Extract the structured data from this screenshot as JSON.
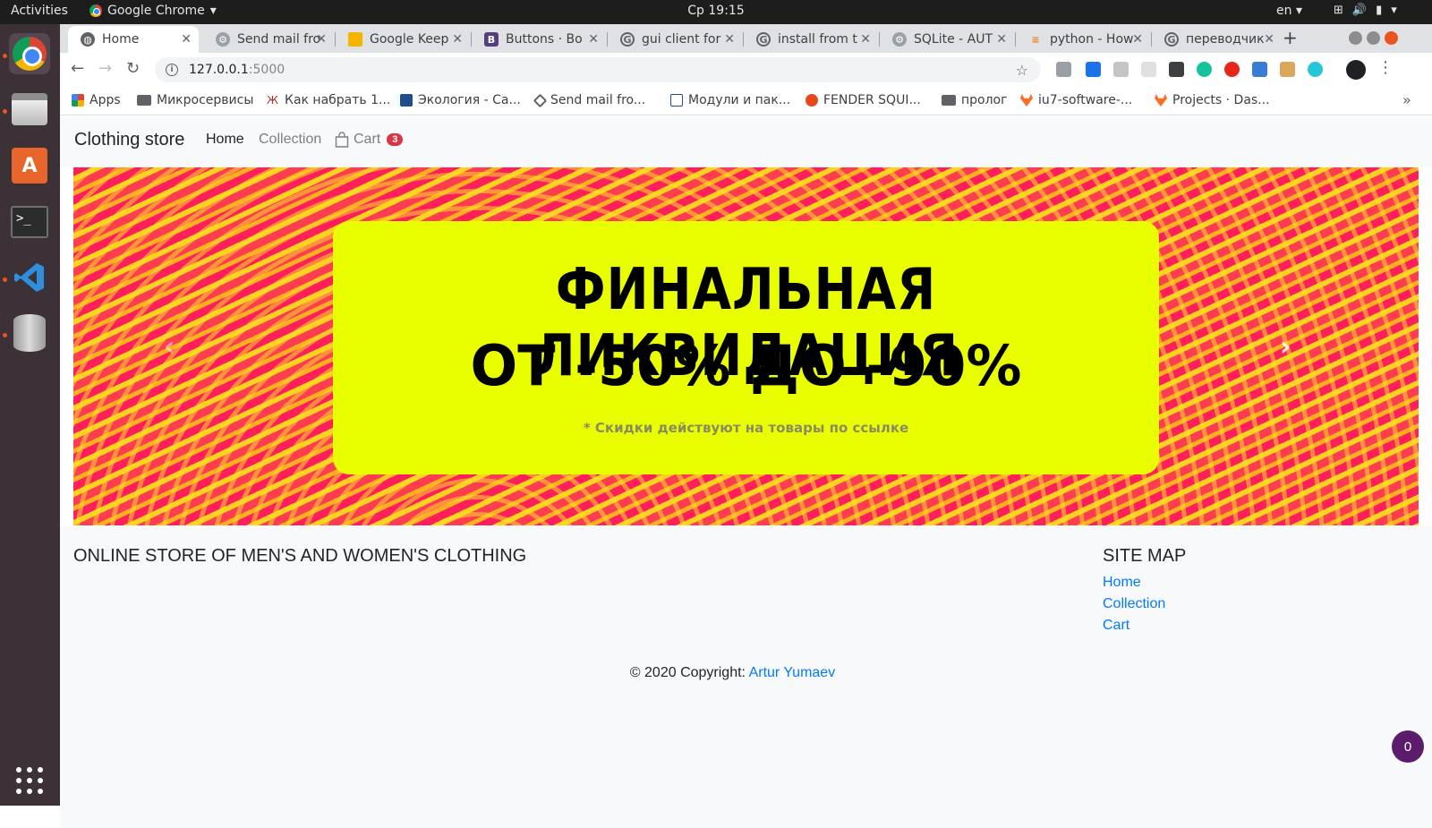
{
  "topbar": {
    "activities": "Activities",
    "app_name": "Google Chrome",
    "clock": "Ср 19:15",
    "lang": "en"
  },
  "tabs": [
    {
      "title": "Home",
      "favicon": "globe-icon",
      "active": true
    },
    {
      "title": "Send mail fro",
      "favicon": "gear-icon"
    },
    {
      "title": "Google Keep",
      "favicon": "keep-icon"
    },
    {
      "title": "Buttons · Bo",
      "favicon": "bootstrap-icon"
    },
    {
      "title": "gui client for",
      "favicon": "google-icon"
    },
    {
      "title": "install from t",
      "favicon": "google-icon"
    },
    {
      "title": "SQLite - AUT",
      "favicon": "gear-icon"
    },
    {
      "title": "python - How",
      "favicon": "stackoverflow-icon"
    },
    {
      "title": "переводчик",
      "favicon": "google-icon"
    }
  ],
  "omnibox": {
    "host": "127.0.0.1",
    "port": ":5000"
  },
  "bookmarks": [
    {
      "label": "Apps",
      "icon": "apps-grid-icon"
    },
    {
      "label": "Микросервисы",
      "icon": "folder-icon"
    },
    {
      "label": "Как набрать 1...",
      "icon": "page-icon"
    },
    {
      "label": "Экология - Са...",
      "icon": "e9-icon"
    },
    {
      "label": "Send mail fro...",
      "icon": "diamond-icon"
    },
    {
      "label": "Модули и пак...",
      "icon": "chart-icon"
    },
    {
      "label": "FENDER SQUI...",
      "icon": "circle-icon"
    },
    {
      "label": "пролог",
      "icon": "folder-icon"
    },
    {
      "label": "iu7-software-...",
      "icon": "gitlab-icon"
    },
    {
      "label": "Projects · Das...",
      "icon": "gitlab-icon"
    }
  ],
  "site": {
    "brand": "Clothing store",
    "nav": {
      "home": "Home",
      "collection": "Collection",
      "cart": "Cart",
      "cart_count": "3"
    },
    "banner": {
      "line1": "ФИНАЛЬНАЯ ЛИКВИДАЦИЯ",
      "line2": "ОТ -50% ДО -90%",
      "note": "* Скидки действуют на товары по ссылке"
    },
    "footer": {
      "title": "ONLINE STORE OF MEN'S AND WOMEN'S CLOTHING",
      "sitemap_title": "SITE MAP",
      "links": [
        "Home",
        "Collection",
        "Cart"
      ],
      "copyright_prefix": "© 2020 Copyright:",
      "author": "Artur Yumaev"
    }
  },
  "float_badge": "0",
  "colors": {
    "link": "#007bff",
    "badge": "#dc3545",
    "banner_bg": "#e9ff00",
    "navbar_bg": "#f8f9fa"
  }
}
